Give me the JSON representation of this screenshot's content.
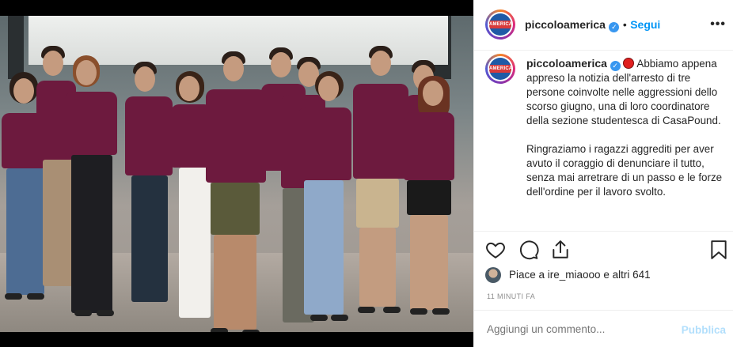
{
  "post": {
    "username": "piccoloamerica",
    "follow_label": "Segui",
    "separator": "•",
    "more_label": "•••",
    "avatar_text": "AMERICA"
  },
  "caption": {
    "username": "piccoloamerica",
    "paragraph_1": "Abbiamo appena appreso la notizia dell'arresto di tre persone coinvolte nelle aggressioni dello scorso giugno, una di loro coordinatore della sezione studentesca di CasaPound.",
    "paragraph_2": "Ringraziamo i ragazzi aggrediti per aver avuto il coraggio di denunciare il tutto, senza mai arretrare di un passo e le forze dell'ordine per il lavoro svolto."
  },
  "likes": {
    "text": "Piace a ire_miaooo e altri 641"
  },
  "timestamp": "11 MINUTI FA",
  "comment": {
    "placeholder": "Aggiungi un commento...",
    "publish_label": "Pubblica"
  },
  "icons": {
    "like": "heart-icon",
    "comment": "comment-icon",
    "share": "share-icon",
    "save": "bookmark-icon",
    "verified": "verified-icon"
  },
  "colors": {
    "accent": "#0095f6",
    "shirt": "#6d1a3e",
    "publish_disabled": "#b2dffc"
  }
}
